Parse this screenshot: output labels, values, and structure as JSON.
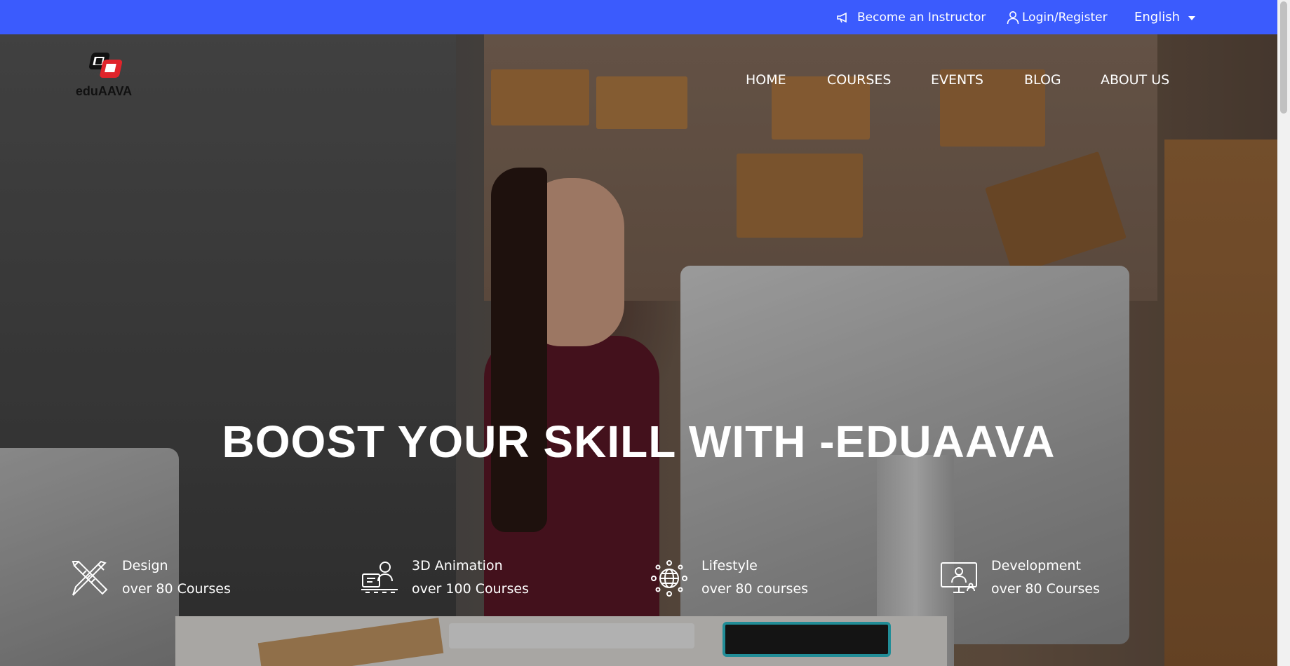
{
  "topbar": {
    "instructor_label": "Become an Instructor",
    "login_label": "Login/Register",
    "language": "English",
    "background": "#3b5bfd"
  },
  "logo": {
    "text": "eduAAVA",
    "accent": "#e0242b"
  },
  "nav": {
    "items": [
      "HOME",
      "COURSES",
      "EVENTS",
      "BLOG",
      "ABOUT US"
    ]
  },
  "hero": {
    "headline": "BOOST YOUR SKILL WITH -EDUAAVA"
  },
  "categories": [
    {
      "title": "Design",
      "subtitle": "over 80 Courses",
      "icon": "design-tools-icon"
    },
    {
      "title": "3D Animation",
      "subtitle": "over 100 Courses",
      "icon": "animator-icon"
    },
    {
      "title": "Lifestyle",
      "subtitle": "over 80 courses",
      "icon": "globe-network-icon"
    },
    {
      "title": "Development",
      "subtitle": "over 80 Courses",
      "icon": "developer-monitor-icon"
    }
  ]
}
